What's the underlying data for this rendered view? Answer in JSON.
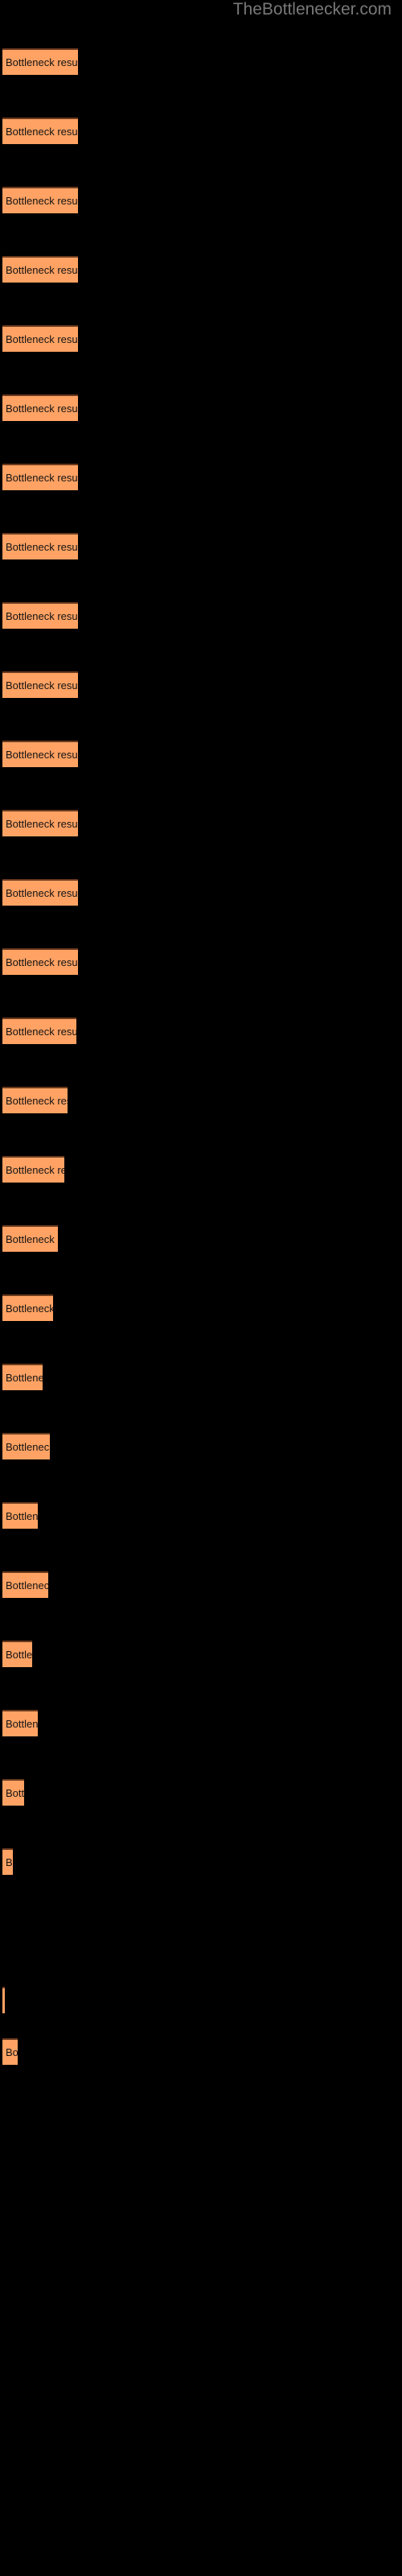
{
  "watermark": "TheBottlenecker.com",
  "background_color": "#000000",
  "bar_color": "#ffa263",
  "bar_border_color": "#6b3a1e",
  "label_color": "#141414",
  "watermark_color": "#787878",
  "bar_label": "Bottleneck result",
  "chart_data": {
    "type": "bar",
    "orientation": "horizontal",
    "title": "",
    "subtitle": "",
    "xlabel": "",
    "ylabel": "",
    "grid": false,
    "legend": null,
    "xlim": [
      0,
      500
    ],
    "categories": [
      "Bottleneck result",
      "Bottleneck result",
      "Bottleneck result",
      "Bottleneck result",
      "Bottleneck result",
      "Bottleneck result",
      "Bottleneck result",
      "Bottleneck result",
      "Bottleneck result",
      "Bottleneck result",
      "Bottleneck result",
      "Bottleneck result",
      "Bottleneck result",
      "Bottleneck result",
      "Bottleneck result",
      "Bottleneck result",
      "Bottleneck result",
      "Bottleneck result",
      "Bottleneck result",
      "Bottleneck result",
      "Bottleneck result",
      "Bottleneck result",
      "Bottleneck result",
      "Bottleneck result",
      "Bottleneck result",
      "Bottleneck result",
      "Bottleneck result",
      "Bottleneck result",
      "Bottleneck result"
    ],
    "values": [
      94,
      94,
      94,
      94,
      94,
      94,
      94,
      94,
      94,
      94,
      94,
      94,
      94,
      94,
      92,
      81,
      77,
      69,
      63,
      50,
      59,
      44,
      57,
      37,
      44,
      27,
      13,
      3,
      19
    ],
    "bars": [
      {
        "label": "Bottleneck result",
        "width": 94,
        "top": 60
      },
      {
        "label": "Bottleneck result",
        "width": 94,
        "top": 146
      },
      {
        "label": "Bottleneck result",
        "width": 94,
        "top": 232
      },
      {
        "label": "Bottleneck result",
        "width": 94,
        "top": 318
      },
      {
        "label": "Bottleneck result",
        "width": 94,
        "top": 404
      },
      {
        "label": "Bottleneck result",
        "width": 94,
        "top": 490
      },
      {
        "label": "Bottleneck result",
        "width": 94,
        "top": 576
      },
      {
        "label": "Bottleneck result",
        "width": 94,
        "top": 662
      },
      {
        "label": "Bottleneck result",
        "width": 94,
        "top": 748
      },
      {
        "label": "Bottleneck result",
        "width": 94,
        "top": 834
      },
      {
        "label": "Bottleneck result",
        "width": 94,
        "top": 920
      },
      {
        "label": "Bottleneck result",
        "width": 94,
        "top": 1006
      },
      {
        "label": "Bottleneck result",
        "width": 94,
        "top": 1092
      },
      {
        "label": "Bottleneck result",
        "width": 94,
        "top": 1178
      },
      {
        "label": "Bottleneck result",
        "width": 92,
        "top": 1264
      },
      {
        "label": "Bottleneck result",
        "width": 81,
        "top": 1350
      },
      {
        "label": "Bottleneck result",
        "width": 77,
        "top": 1436
      },
      {
        "label": "Bottleneck result",
        "width": 69,
        "top": 1522
      },
      {
        "label": "Bottleneck result",
        "width": 63,
        "top": 1608
      },
      {
        "label": "Bottleneck result",
        "width": 50,
        "top": 1694
      },
      {
        "label": "Bottleneck result",
        "width": 59,
        "top": 1780
      },
      {
        "label": "Bottleneck result",
        "width": 44,
        "top": 1866
      },
      {
        "label": "Bottleneck result",
        "width": 57,
        "top": 1952
      },
      {
        "label": "Bottleneck result",
        "width": 37,
        "top": 2038
      },
      {
        "label": "Bottleneck result",
        "width": 44,
        "top": 2124
      },
      {
        "label": "Bottleneck result",
        "width": 27,
        "top": 2210
      },
      {
        "label": "Bottleneck result",
        "width": 13,
        "top": 2296
      },
      {
        "label": "Bottleneck result",
        "width": 3,
        "top": 2468
      },
      {
        "label": "Bottleneck result",
        "width": 19,
        "top": 2532
      }
    ]
  }
}
